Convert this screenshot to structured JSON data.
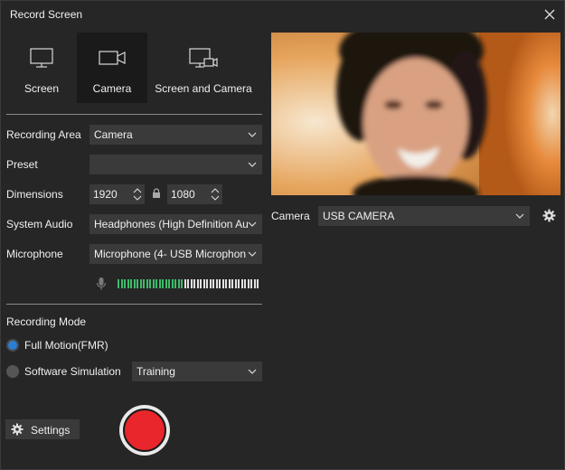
{
  "window": {
    "title": "Record Screen"
  },
  "modes": [
    {
      "label": "Screen",
      "icon": "monitor-icon",
      "active": false
    },
    {
      "label": "Camera",
      "icon": "video-camera-icon",
      "active": true
    },
    {
      "label": "Screen and Camera",
      "icon": "monitor-camera-icon",
      "active": false
    }
  ],
  "form": {
    "recording_area": {
      "label": "Recording Area",
      "value": "Camera"
    },
    "preset": {
      "label": "Preset",
      "value": ""
    },
    "dimensions": {
      "label": "Dimensions",
      "width": "1920",
      "height": "1080",
      "lock_icon": "lock-icon"
    },
    "system_audio": {
      "label": "System Audio",
      "value": "Headphones (High Definition Au"
    },
    "microphone": {
      "label": "Microphone",
      "value": "Microphone (4- USB Microphon",
      "icon": "microphone-icon",
      "level_pct": 47
    }
  },
  "recording_mode": {
    "label": "Recording Mode",
    "options": [
      {
        "label": "Full Motion(FMR)",
        "selected": true
      },
      {
        "label": "Software Simulation",
        "selected": false
      }
    ],
    "simulation_type": "Training"
  },
  "footer": {
    "settings_label": "Settings"
  },
  "camera": {
    "label": "Camera",
    "device": "USB CAMERA"
  },
  "colors": {
    "accent": "#2a7fd4",
    "record": "#e8262b",
    "level_active": "#3dbb6a",
    "level_idle": "#e0e0e0"
  }
}
